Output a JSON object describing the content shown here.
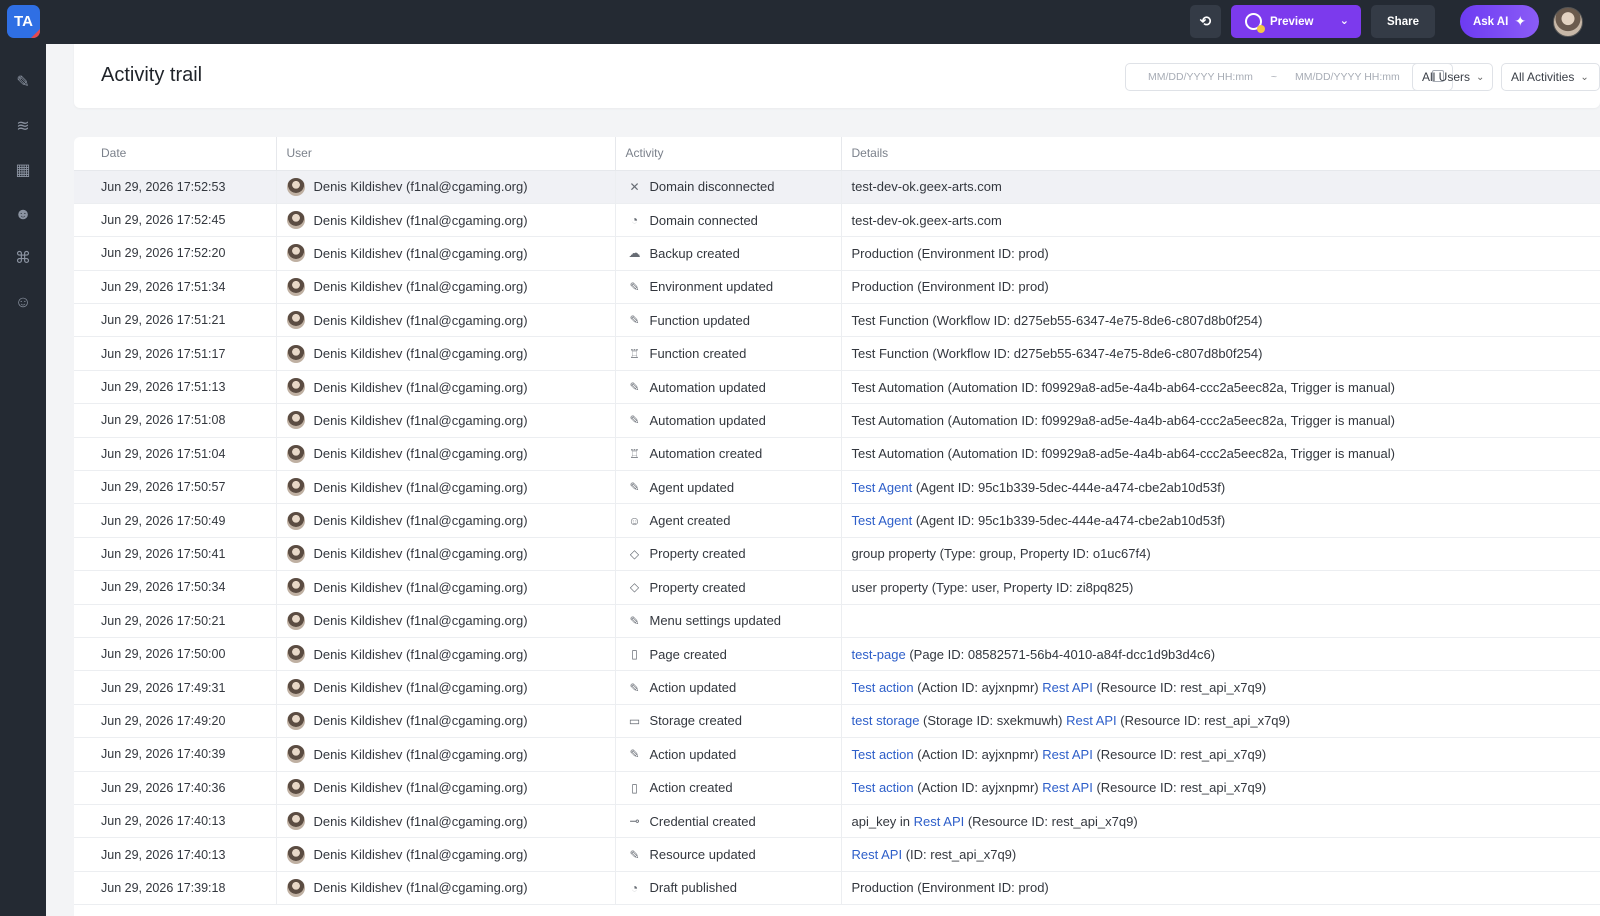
{
  "app": {
    "logo_text": "TA",
    "preview_label": "Preview",
    "share_label": "Share",
    "ask_ai_label": "Ask AI",
    "colors": {
      "topbar": "#242a33",
      "accent": "#7c3aed",
      "link": "#2d5ec9",
      "logo": "#2f6fe4"
    }
  },
  "sidebar": {
    "icons": [
      "design-icon",
      "database-icon",
      "layout-icon",
      "users-icon",
      "org-chart-icon",
      "agent-icon"
    ]
  },
  "header": {
    "title": "Activity trail",
    "date_from_placeholder": "MM/DD/YYYY HH:mm",
    "date_sep": "~",
    "date_to_placeholder": "MM/DD/YYYY HH:mm",
    "users_filter": "All Users",
    "activities_filter": "All Activities"
  },
  "table": {
    "columns": [
      "Date",
      "User",
      "Activity",
      "Details"
    ],
    "user_name": "Denis Kildishev (f1nal@cgaming.org)",
    "rows": [
      {
        "date": "Jun 29, 2026 17:52:53",
        "icon": "✕",
        "activity": "Domain disconnected",
        "details": [
          {
            "t": "test-dev-ok.geex-arts.com"
          }
        ]
      },
      {
        "date": "Jun 29, 2026 17:52:45",
        "icon": "◔",
        "activity": "Domain connected",
        "details": [
          {
            "t": "test-dev-ok.geex-arts.com"
          }
        ]
      },
      {
        "date": "Jun 29, 2026 17:52:20",
        "icon": "☁",
        "activity": "Backup created",
        "details": [
          {
            "t": "Production (Environment ID: prod)"
          }
        ]
      },
      {
        "date": "Jun 29, 2026 17:51:34",
        "icon": "✎",
        "activity": "Environment updated",
        "details": [
          {
            "t": "Production (Environment ID: prod)"
          }
        ]
      },
      {
        "date": "Jun 29, 2026 17:51:21",
        "icon": "✎",
        "activity": "Function updated",
        "details": [
          {
            "t": "Test Function (Workflow ID: d275eb55-6347-4e75-8de6-c807d8b0f254)"
          }
        ]
      },
      {
        "date": "Jun 29, 2026 17:51:17",
        "icon": "♖",
        "activity": "Function created",
        "details": [
          {
            "t": "Test Function (Workflow ID: d275eb55-6347-4e75-8de6-c807d8b0f254)"
          }
        ]
      },
      {
        "date": "Jun 29, 2026 17:51:13",
        "icon": "✎",
        "activity": "Automation updated",
        "details": [
          {
            "t": "Test Automation (Automation ID: f09929a8-ad5e-4a4b-ab64-ccc2a5eec82a, Trigger is manual)"
          }
        ]
      },
      {
        "date": "Jun 29, 2026 17:51:08",
        "icon": "✎",
        "activity": "Automation updated",
        "details": [
          {
            "t": "Test Automation (Automation ID: f09929a8-ad5e-4a4b-ab64-ccc2a5eec82a, Trigger is manual)"
          }
        ]
      },
      {
        "date": "Jun 29, 2026 17:51:04",
        "icon": "♖",
        "activity": "Automation created",
        "details": [
          {
            "t": "Test Automation (Automation ID: f09929a8-ad5e-4a4b-ab64-ccc2a5eec82a, Trigger is manual)"
          }
        ]
      },
      {
        "date": "Jun 29, 2026 17:50:57",
        "icon": "✎",
        "activity": "Agent updated",
        "details": [
          {
            "t": "Test Agent",
            "link": true
          },
          {
            "t": " (Agent ID: 95c1b339-5dec-444e-a474-cbe2ab10d53f)"
          }
        ]
      },
      {
        "date": "Jun 29, 2026 17:50:49",
        "icon": "☺",
        "activity": "Agent created",
        "details": [
          {
            "t": "Test Agent",
            "link": true
          },
          {
            "t": " (Agent ID: 95c1b339-5dec-444e-a474-cbe2ab10d53f)"
          }
        ]
      },
      {
        "date": "Jun 29, 2026 17:50:41",
        "icon": "◇",
        "activity": "Property created",
        "details": [
          {
            "t": "group property (Type: group, Property ID: o1uc67f4)"
          }
        ]
      },
      {
        "date": "Jun 29, 2026 17:50:34",
        "icon": "◇",
        "activity": "Property created",
        "details": [
          {
            "t": "user property (Type: user, Property ID: zi8pq825)"
          }
        ]
      },
      {
        "date": "Jun 29, 2026 17:50:21",
        "icon": "✎",
        "activity": "Menu settings updated",
        "details": []
      },
      {
        "date": "Jun 29, 2026 17:50:00",
        "icon": "▯",
        "activity": "Page created",
        "details": [
          {
            "t": "test-page",
            "link": true
          },
          {
            "t": " (Page ID: 08582571-56b4-4010-a84f-dcc1d9b3d4c6)"
          }
        ]
      },
      {
        "date": "Jun 29, 2026 17:49:31",
        "icon": "✎",
        "activity": "Action updated",
        "details": [
          {
            "t": "Test action",
            "link": true
          },
          {
            "t": " (Action ID: ayjxnpmr) "
          },
          {
            "t": "Rest API",
            "link": true
          },
          {
            "t": " (Resource ID: rest_api_x7q9)"
          }
        ]
      },
      {
        "date": "Jun 29, 2026 17:49:20",
        "icon": "▭",
        "activity": "Storage created",
        "details": [
          {
            "t": "test storage",
            "link": true
          },
          {
            "t": " (Storage ID: sxekmuwh) "
          },
          {
            "t": "Rest API",
            "link": true
          },
          {
            "t": " (Resource ID: rest_api_x7q9)"
          }
        ]
      },
      {
        "date": "Jun 29, 2026 17:40:39",
        "icon": "✎",
        "activity": "Action updated",
        "details": [
          {
            "t": "Test action",
            "link": true
          },
          {
            "t": " (Action ID: ayjxnpmr) "
          },
          {
            "t": "Rest API",
            "link": true
          },
          {
            "t": " (Resource ID: rest_api_x7q9)"
          }
        ]
      },
      {
        "date": "Jun 29, 2026 17:40:36",
        "icon": "▯",
        "activity": "Action created",
        "details": [
          {
            "t": "Test action",
            "link": true
          },
          {
            "t": " (Action ID: ayjxnpmr) "
          },
          {
            "t": "Rest API",
            "link": true
          },
          {
            "t": " (Resource ID: rest_api_x7q9)"
          }
        ]
      },
      {
        "date": "Jun 29, 2026 17:40:13",
        "icon": "⊸",
        "activity": "Credential created",
        "details": [
          {
            "t": "api_key in "
          },
          {
            "t": "Rest API",
            "link": true
          },
          {
            "t": " (Resource ID: rest_api_x7q9)"
          }
        ]
      },
      {
        "date": "Jun 29, 2026 17:40:13",
        "icon": "✎",
        "activity": "Resource updated",
        "details": [
          {
            "t": "Rest API",
            "link": true
          },
          {
            "t": " (ID: rest_api_x7q9)"
          }
        ]
      },
      {
        "date": "Jun 29, 2026 17:39:18",
        "icon": "◔",
        "activity": "Draft published",
        "details": [
          {
            "t": "Production (Environment ID: prod)"
          }
        ]
      }
    ]
  }
}
